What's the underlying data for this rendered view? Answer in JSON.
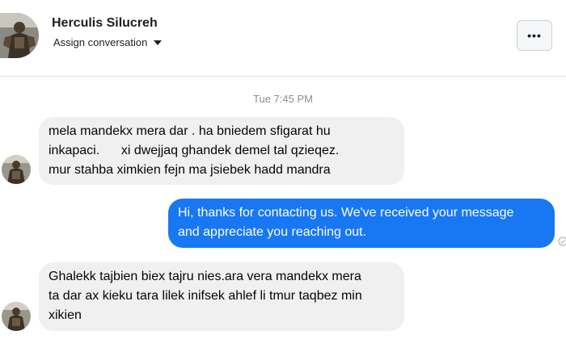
{
  "header": {
    "contact_name": "Herculis Silucreh",
    "assign_label": "Assign conversation",
    "more_label": "•••"
  },
  "thread": {
    "timestamp": "Tue 7:45 PM",
    "messages": [
      {
        "direction": "incoming",
        "text": "mela mandekx mera dar . ha bniedem sfigarat hu\ninkapaci.      xi dwejjaq ghandek demel tal qzieqez.\nmur stahba ximkien fejn ma jsiebek hadd mandra"
      },
      {
        "direction": "outgoing",
        "text": "Hi, thanks for contacting us. We've received your message\nand appreciate you reaching out."
      },
      {
        "direction": "incoming",
        "text": "Ghalekk tajbien biex tajru nies.ara vera mandekx mera\nta dar ax kieku tara lilek inifsek ahlef li tmur taqbez min\nxikien"
      }
    ]
  },
  "colors": {
    "outgoing_bubble": "#1877f2",
    "incoming_bubble": "#f0f0f0",
    "timestamp": "#8a8d91"
  }
}
